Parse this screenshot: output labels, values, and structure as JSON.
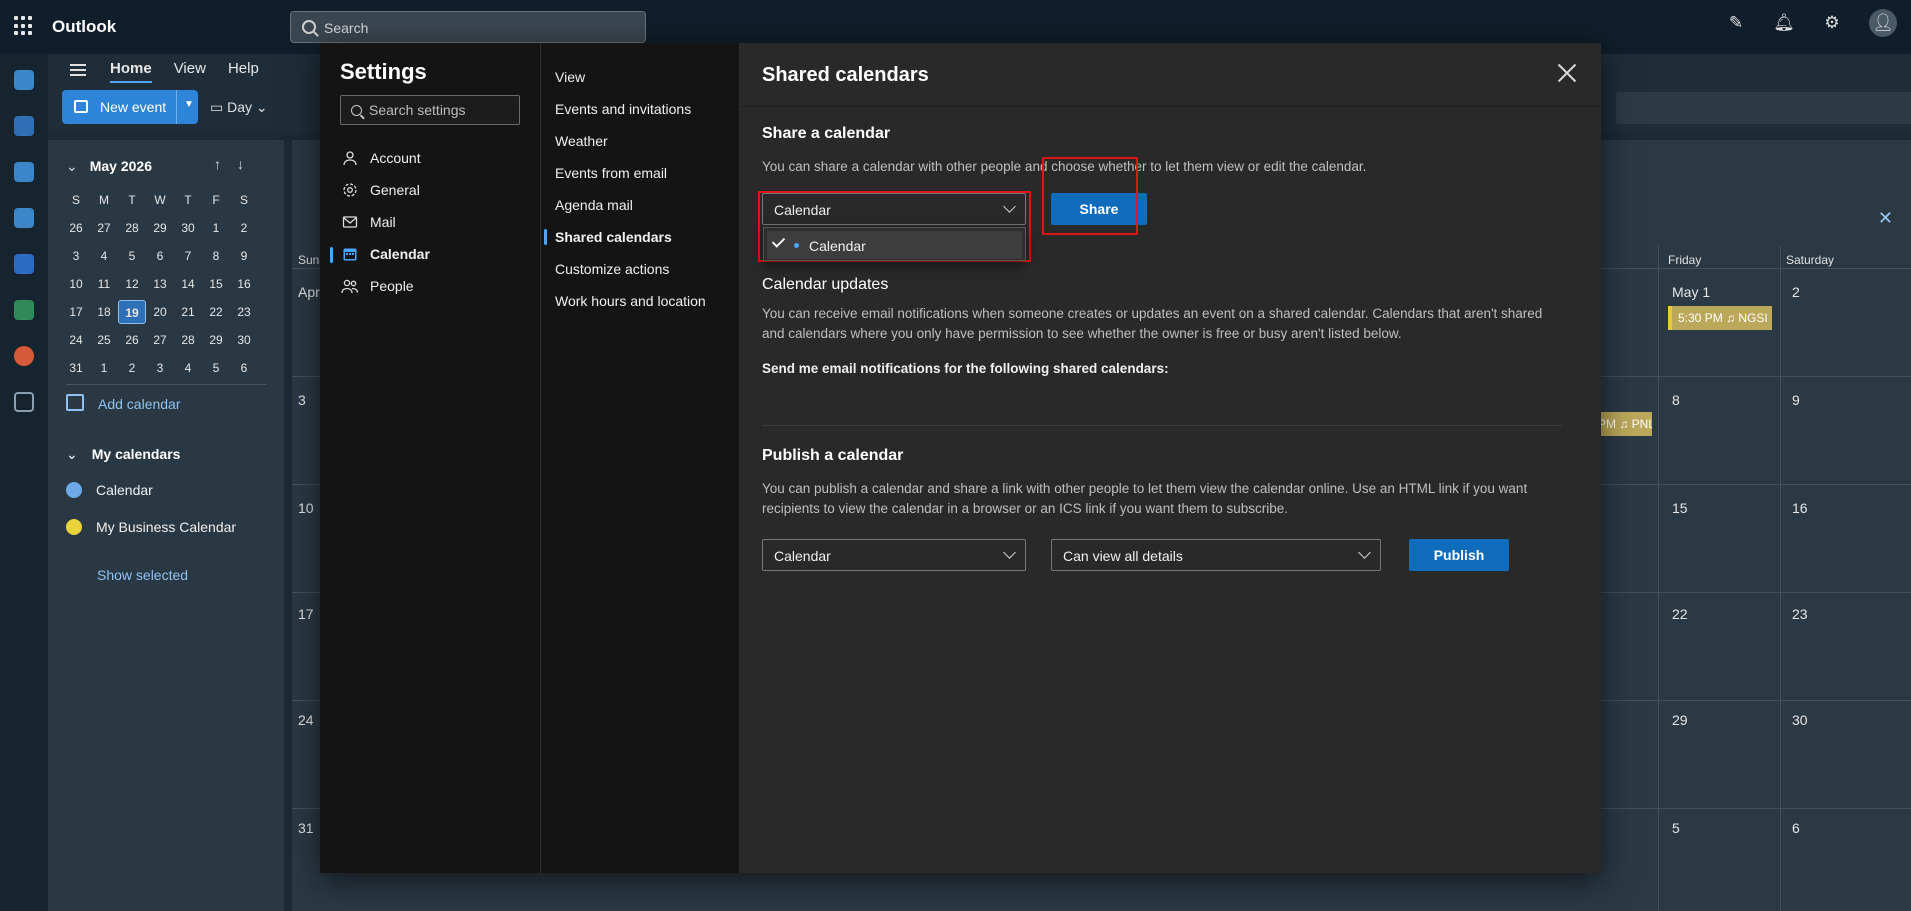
{
  "app": {
    "brand": "Outlook",
    "search_placeholder": "Search",
    "ribbon_tabs": [
      "Home",
      "View",
      "Help"
    ],
    "new_event_label": "New event",
    "day_label": "Day"
  },
  "mini_calendar": {
    "month_label": "May 2026",
    "weekdays": [
      "S",
      "M",
      "T",
      "W",
      "T",
      "F",
      "S"
    ],
    "days": [
      "26",
      "27",
      "28",
      "29",
      "30",
      "1",
      "2",
      "3",
      "4",
      "5",
      "6",
      "7",
      "8",
      "9",
      "10",
      "11",
      "12",
      "13",
      "14",
      "15",
      "16",
      "17",
      "18",
      "19",
      "20",
      "21",
      "22",
      "23",
      "24",
      "25",
      "26",
      "27",
      "28",
      "29",
      "30",
      "31",
      "1",
      "2",
      "3",
      "4",
      "5",
      "6"
    ],
    "today": "19"
  },
  "nav": {
    "add_calendar": "Add calendar",
    "my_calendars": "My calendars",
    "calendars": [
      {
        "name": "Calendar",
        "color": "#6fa8e8"
      },
      {
        "name": "My Business Calendar",
        "color": "#e8d43a"
      }
    ],
    "show_selected": "Show selected"
  },
  "calendar_grid": {
    "headers": [
      "Sun",
      "Friday",
      "Saturday"
    ],
    "day_numbers": {
      "apr": "Apr",
      "may1": "May 1",
      "d2": "2",
      "d3": "3",
      "d8": "8",
      "d9": "9",
      "d10": "10",
      "d15": "15",
      "d16": "16",
      "d17": "17",
      "d22": "22",
      "d23": "23",
      "d24": "24",
      "d29": "29",
      "d30": "30",
      "d31": "31",
      "d5": "5",
      "d6": "6"
    },
    "events": {
      "fri": "5:30 PM ♫ NGSI",
      "thu": "PM ♫ PNL"
    }
  },
  "settings": {
    "title": "Settings",
    "search_placeholder": "Search settings",
    "categories": [
      "Account",
      "General",
      "Mail",
      "Calendar",
      "People"
    ],
    "active_category": "Calendar",
    "subcategories": [
      "View",
      "Events and invitations",
      "Weather",
      "Events from email",
      "Agenda mail",
      "Shared calendars",
      "Customize actions",
      "Work hours and location"
    ],
    "active_subcategory": "Shared calendars"
  },
  "shared_calendars": {
    "page_title": "Shared calendars",
    "share_heading": "Share a calendar",
    "share_desc": "You can share a calendar with other people and choose whether to let them view or edit the calendar.",
    "share_select_value": "Calendar",
    "share_button": "Share",
    "dropdown_options": [
      "Calendar"
    ],
    "updates_heading": "Calendar updates",
    "updates_desc": "You can receive email notifications when someone creates or updates an event on a shared calendar. Calendars that aren't shared and calendars where you only have permission to see whether the owner is free or busy aren't listed below.",
    "updates_label": "Send me email notifications for the following shared calendars:",
    "publish_heading": "Publish a calendar",
    "publish_desc": "You can publish a calendar and share a link with other people to let them view the calendar online. Use an HTML link if you want recipients to view the calendar in a browser or an ICS link if you want them to subscribe.",
    "publish_calendar_value": "Calendar",
    "publish_permission_value": "Can view all details",
    "publish_button": "Publish"
  }
}
